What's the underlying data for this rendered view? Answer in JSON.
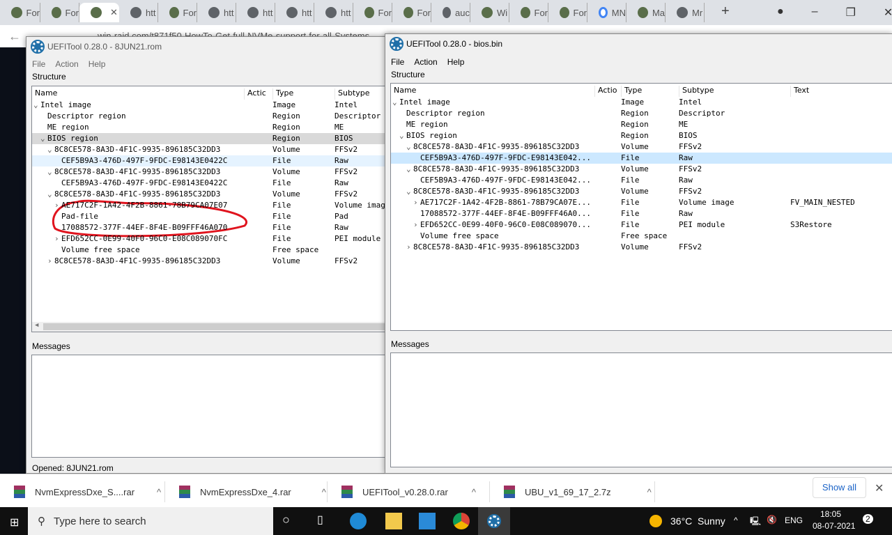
{
  "browser": {
    "tabs": [
      {
        "label": "For",
        "icon": "forum-icon"
      },
      {
        "label": "For",
        "icon": "forum-icon"
      },
      {
        "label": "",
        "icon": "forum-icon",
        "active": true
      },
      {
        "label": "htt",
        "icon": "globe-icon"
      },
      {
        "label": "For",
        "icon": "forum-icon"
      },
      {
        "label": "htt",
        "icon": "globe-icon"
      },
      {
        "label": "htt",
        "icon": "globe-icon"
      },
      {
        "label": "htt",
        "icon": "globe-icon"
      },
      {
        "label": "htt",
        "icon": "globe-icon"
      },
      {
        "label": "For",
        "icon": "forum-icon"
      },
      {
        "label": "For",
        "icon": "forum-icon"
      },
      {
        "label": "auc",
        "icon": "globe-icon"
      },
      {
        "label": "Wi",
        "icon": "forum-icon"
      },
      {
        "label": "For",
        "icon": "forum-icon"
      },
      {
        "label": "For",
        "icon": "forum-icon"
      },
      {
        "label": "MN",
        "icon": "google-icon"
      },
      {
        "label": "Ma",
        "icon": "avatar-icon"
      },
      {
        "label": "Mr",
        "icon": "globe-icon"
      }
    ],
    "url": "win-raid.com/t871f50-HowTo-Get-full-NVMe-support-for-all-Systems..."
  },
  "left_window": {
    "title": "UEFITool 0.28.0 - 8JUN21.rom",
    "menu": [
      "File",
      "Action",
      "Help"
    ],
    "structure_label": "Structure",
    "columns": [
      "Name",
      "Actic",
      "Type",
      "Subtype"
    ],
    "rows": [
      {
        "level": 0,
        "exp": "v",
        "name": "Intel image",
        "type": "Image",
        "subtype": "Intel"
      },
      {
        "level": 1,
        "exp": "",
        "name": "Descriptor region",
        "type": "Region",
        "subtype": "Descriptor"
      },
      {
        "level": 1,
        "exp": "",
        "name": "ME region",
        "type": "Region",
        "subtype": "ME"
      },
      {
        "level": 1,
        "exp": "v",
        "name": "BIOS region",
        "type": "Region",
        "subtype": "BIOS",
        "state": "sel"
      },
      {
        "level": 2,
        "exp": "v",
        "name": "8C8CE578-8A3D-4F1C-9935-896185C32DD3",
        "type": "Volume",
        "subtype": "FFSv2"
      },
      {
        "level": 3,
        "exp": "",
        "name": "CEF5B9A3-476D-497F-9FDC-E98143E0422C",
        "type": "File",
        "subtype": "Raw",
        "state": "hov"
      },
      {
        "level": 2,
        "exp": "v",
        "name": "8C8CE578-8A3D-4F1C-9935-896185C32DD3",
        "type": "Volume",
        "subtype": "FFSv2"
      },
      {
        "level": 3,
        "exp": "",
        "name": "CEF5B9A3-476D-497F-9FDC-E98143E0422C",
        "type": "File",
        "subtype": "Raw"
      },
      {
        "level": 2,
        "exp": "v",
        "name": "8C8CE578-8A3D-4F1C-9935-896185C32DD3",
        "type": "Volume",
        "subtype": "FFSv2"
      },
      {
        "level": 3,
        "exp": ">",
        "name": "AE717C2F-1A42-4F2B-8861-78B79CA07E07",
        "type": "File",
        "subtype": "Volume image"
      },
      {
        "level": 3,
        "exp": "",
        "name": "Pad-file",
        "type": "File",
        "subtype": "Pad"
      },
      {
        "level": 3,
        "exp": "",
        "name": "17088572-377F-44EF-8F4E-B09FFF46A070",
        "type": "File",
        "subtype": "Raw"
      },
      {
        "level": 3,
        "exp": ">",
        "name": "EFD652CC-0E99-40F0-96C0-E08C089070FC",
        "type": "File",
        "subtype": "PEI module"
      },
      {
        "level": 3,
        "exp": "",
        "name": "Volume free space",
        "type": "Free space",
        "subtype": ""
      },
      {
        "level": 2,
        "exp": ">",
        "name": "8C8CE578-8A3D-4F1C-9935-896185C32DD3",
        "type": "Volume",
        "subtype": "FFSv2"
      }
    ],
    "messages_label": "Messages",
    "status": "Opened: 8JUN21.rom",
    "annotation_color": "#e0141e"
  },
  "right_window": {
    "title": "UEFITool 0.28.0 - bios.bin",
    "menu": [
      "File",
      "Action",
      "Help"
    ],
    "structure_label": "Structure",
    "columns": [
      "Name",
      "Actio",
      "Type",
      "Subtype",
      "Text"
    ],
    "rows": [
      {
        "level": 0,
        "exp": "v",
        "name": "Intel image",
        "type": "Image",
        "subtype": "Intel",
        "text": ""
      },
      {
        "level": 1,
        "exp": "",
        "name": "Descriptor region",
        "type": "Region",
        "subtype": "Descriptor",
        "text": ""
      },
      {
        "level": 1,
        "exp": "",
        "name": "ME region",
        "type": "Region",
        "subtype": "ME",
        "text": ""
      },
      {
        "level": 1,
        "exp": "v",
        "name": "BIOS region",
        "type": "Region",
        "subtype": "BIOS",
        "text": ""
      },
      {
        "level": 2,
        "exp": "v",
        "name": "8C8CE578-8A3D-4F1C-9935-896185C32DD3",
        "type": "Volume",
        "subtype": "FFSv2",
        "text": ""
      },
      {
        "level": 3,
        "exp": "",
        "name": "CEF5B9A3-476D-497F-9FDC-E98143E042...",
        "type": "File",
        "subtype": "Raw",
        "text": "",
        "state": "hl"
      },
      {
        "level": 2,
        "exp": "v",
        "name": "8C8CE578-8A3D-4F1C-9935-896185C32DD3",
        "type": "Volume",
        "subtype": "FFSv2",
        "text": ""
      },
      {
        "level": 3,
        "exp": "",
        "name": "CEF5B9A3-476D-497F-9FDC-E98143E042...",
        "type": "File",
        "subtype": "Raw",
        "text": ""
      },
      {
        "level": 2,
        "exp": "v",
        "name": "8C8CE578-8A3D-4F1C-9935-896185C32DD3",
        "type": "Volume",
        "subtype": "FFSv2",
        "text": ""
      },
      {
        "level": 3,
        "exp": ">",
        "name": "AE717C2F-1A42-4F2B-8861-78B79CA07E...",
        "type": "File",
        "subtype": "Volume image",
        "text": "FV_MAIN_NESTED"
      },
      {
        "level": 3,
        "exp": "",
        "name": "17088572-377F-44EF-8F4E-B09FFF46A0...",
        "type": "File",
        "subtype": "Raw",
        "text": ""
      },
      {
        "level": 3,
        "exp": ">",
        "name": "EFD652CC-0E99-40F0-96C0-E08C089070...",
        "type": "File",
        "subtype": "PEI module",
        "text": "S3Restore"
      },
      {
        "level": 3,
        "exp": "",
        "name": "Volume free space",
        "type": "Free space",
        "subtype": "",
        "text": ""
      },
      {
        "level": 2,
        "exp": ">",
        "name": "8C8CE578-8A3D-4F1C-9935-896185C32DD3",
        "type": "Volume",
        "subtype": "FFSv2",
        "text": ""
      }
    ],
    "messages_label": "Messages"
  },
  "downloads": {
    "items": [
      "NvmExpressDxe_S....rar",
      "NvmExpressDxe_4.rar",
      "UEFITool_v0.28.0.rar",
      "UBU_v1_69_17_2.7z"
    ],
    "show_all": "Show all"
  },
  "taskbar": {
    "search_placeholder": "Type here to search",
    "weather": "36°C  Sunny",
    "language": "ENG",
    "time": "18:05",
    "date": "08-07-2021",
    "notifications": "2"
  }
}
